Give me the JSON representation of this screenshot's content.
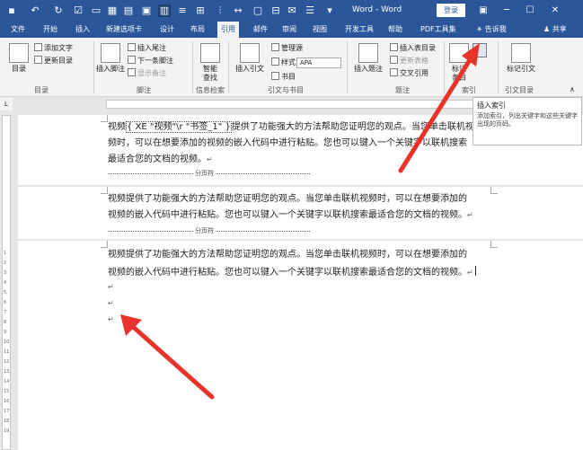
{
  "titlebar": {
    "title": "Word - Word",
    "login": "登录"
  },
  "tabs": [
    "文件",
    "开始",
    "插入",
    "新建选项卡",
    "设计",
    "布局",
    "引用",
    "邮件",
    "审阅",
    "视图",
    "开发工具",
    "帮助",
    "PDF工具集"
  ],
  "tell_me": "告诉我",
  "share": "共享",
  "ribbon": {
    "toc": "目录",
    "add_text": "添加文字",
    "update_table": "更新目录",
    "group_toc": "目录",
    "insert_footnote": "插入脚注",
    "insert_endnote": "插入尾注",
    "next_footnote": "下一条脚注",
    "show_notes": "显示备注",
    "group_footnote": "脚注",
    "smart_lookup": "智能\n查找",
    "group_info": "信息检索",
    "insert_citation": "插入引文",
    "manage_sources": "管理源",
    "style_label": "样式:",
    "style_value": "APA",
    "bibliography": "书目",
    "group_citation": "引文与书目",
    "insert_caption": "插入题注",
    "insert_table_of_figures": "插入表目录",
    "update_table2": "更新表格",
    "cross_reference": "交叉引用",
    "group_caption": "题注",
    "mark_entry": "标记\n条目",
    "group_index": "索引",
    "mark_citation": "标记引文",
    "group_toa": "引文目录"
  },
  "tooltip": {
    "title": "插入索引",
    "body": "添加索引，列出关键字和这些关键字出现的页码。"
  },
  "doc": {
    "p1_l1_field": "{ XE \"视频\"\\r \"书签_1\" }",
    "p1_l1_text": "提供了功能强大的方法帮助您证明您的观点。当您单击联机视",
    "p1_l1_prefix": "视频",
    "p1_l2": "频时，可以在想要添加的视频的嵌入代码中进行粘贴。您也可以键入一个关键字以联机搜索",
    "p1_l3": "最适合您的文档的视频。",
    "page_break": "分页符",
    "p2_l1": "视频提供了功能强大的方法帮助您证明您的观点。当您单击联机视频时，可以在想要添加的",
    "p2_l2": "视频的嵌入代码中进行粘贴。您也可以键入一个关键字以联机搜索最适合您的文档的视频。",
    "p3_l1": "视频提供了功能强大的方法帮助您证明您的观点。当您单击联机视频时，可以在想要添加的",
    "p3_l2": "视频的嵌入代码中进行粘贴。您也可以键入一个关键字以联机搜索最适合您的文档的视频。",
    "para_mark": "↵"
  },
  "vruler_numbers": [
    "1",
    "2",
    "3",
    "4",
    "5",
    "6",
    "7",
    "8",
    "9",
    "10",
    "11",
    "12",
    "13",
    "14",
    "15",
    "16",
    "17",
    "18",
    "19"
  ],
  "colors": {
    "accent": "#2b579a",
    "arrow": "#e8332a"
  }
}
